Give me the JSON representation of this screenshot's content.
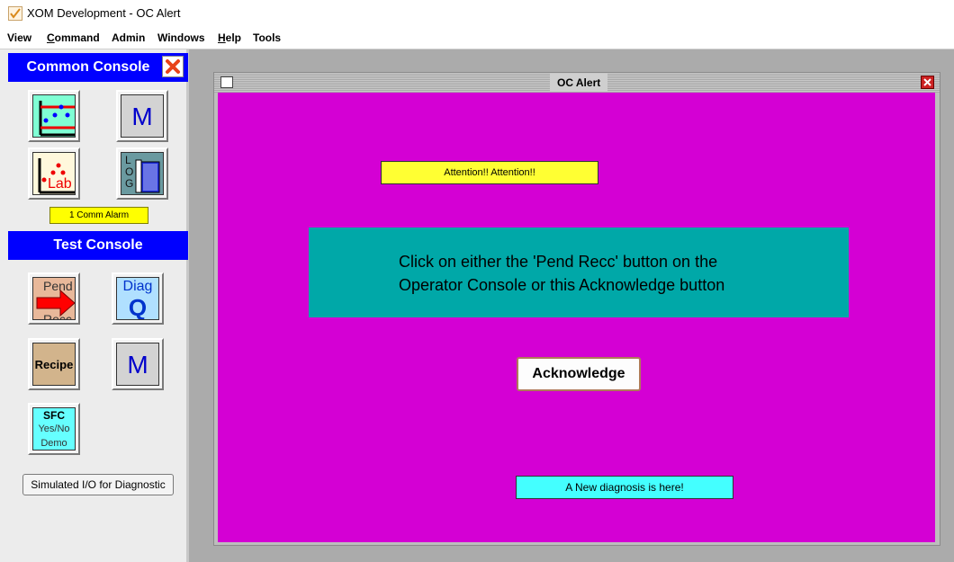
{
  "window": {
    "title": "XOM Development - OC Alert"
  },
  "menu": {
    "items": [
      "View",
      "Command",
      "Admin",
      "Windows",
      "Help",
      "Tools"
    ]
  },
  "common_console": {
    "title": "Common Console",
    "comm_alarm": "1 Comm Alarm",
    "tools": [
      {
        "icon": "trend-chart-icon"
      },
      {
        "icon": "m-icon",
        "text": "M"
      },
      {
        "icon": "lab-icon",
        "text": "Lab"
      },
      {
        "icon": "logbook-icon",
        "text": "LOG"
      }
    ]
  },
  "test_console": {
    "title": "Test Console",
    "tools": [
      {
        "icon": "pend-recc-icon",
        "line1": "Pend",
        "line2": "Recc"
      },
      {
        "icon": "diag-q-icon",
        "line1": "Diag",
        "line2": "Q"
      },
      {
        "icon": "recipe-icon",
        "text": "Recipe"
      },
      {
        "icon": "m-icon",
        "text": "M"
      },
      {
        "icon": "sfc-icon",
        "line1": "SFC",
        "line2": "Yes/No",
        "line3": "Demo"
      }
    ],
    "sim_button": "Simulated I/O for Diagnostic"
  },
  "oc_alert": {
    "title": "OC Alert",
    "attention": "Attention!! Attention!!",
    "instruction_line1": "Click on either the 'Pend Recc' button on the",
    "instruction_line2": "Operator Console or this Acknowledge button",
    "acknowledge": "Acknowledge",
    "diagnosis": "A New diagnosis is here!"
  },
  "colors": {
    "alert_background": "#d400d4",
    "instruction_panel": "#00a8a8",
    "attention_banner": "#ffff33",
    "diagnosis_banner": "#44ffff",
    "console_header": "#0000ff"
  }
}
